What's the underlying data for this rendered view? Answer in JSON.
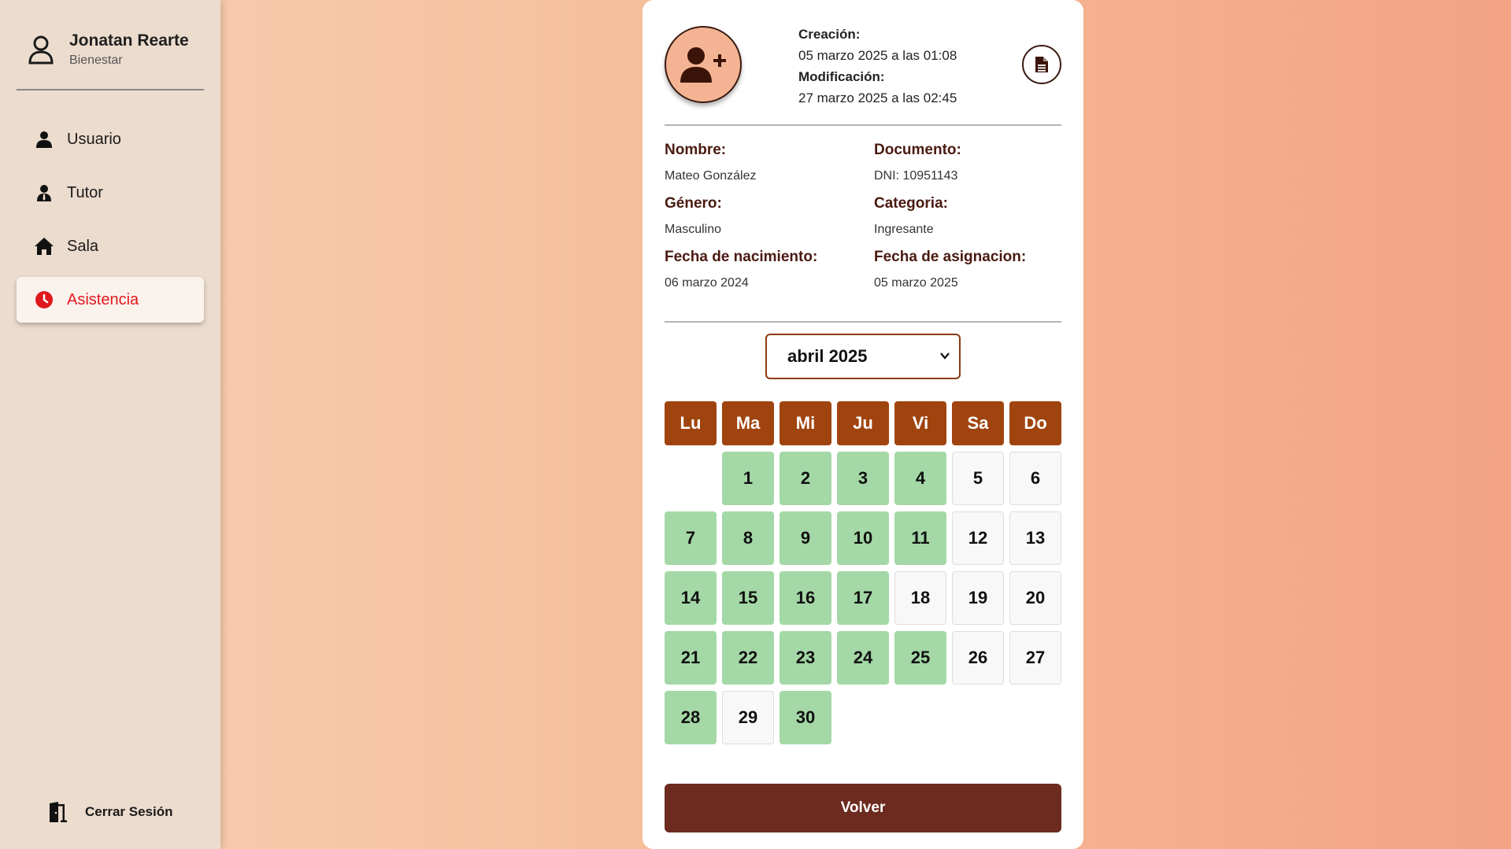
{
  "sidebar": {
    "user_name": "Jonatan Rearte",
    "user_role": "Bienestar",
    "items": [
      {
        "label": "Usuario",
        "icon": "user-icon",
        "active": false
      },
      {
        "label": "Tutor",
        "icon": "tutor-icon",
        "active": false
      },
      {
        "label": "Sala",
        "icon": "home-icon",
        "active": false
      },
      {
        "label": "Asistencia",
        "icon": "clock-icon",
        "active": true
      }
    ],
    "logout_label": "Cerrar Sesión"
  },
  "record": {
    "created_label": "Creación:",
    "created_value": "05 marzo 2025 a las 01:08",
    "modified_label": "Modificación:",
    "modified_value": "27 marzo 2025 a las 02:45"
  },
  "details": {
    "nombre_label": "Nombre:",
    "nombre_value": "Mateo González",
    "documento_label": "Documento:",
    "documento_value": "DNI: 10951143",
    "genero_label": "Género:",
    "genero_value": "Masculino",
    "categoria_label": "Categoria:",
    "categoria_value": "Ingresante",
    "nacimiento_label": "Fecha de nacimiento:",
    "nacimiento_value": "06 marzo 2024",
    "asignacion_label": "Fecha de asignacion:",
    "asignacion_value": "05 marzo 2025"
  },
  "calendar": {
    "selected_month": "abril 2025",
    "weekdays": [
      "Lu",
      "Ma",
      "Mi",
      "Ju",
      "Vi",
      "Sa",
      "Do"
    ],
    "leading_blank_days": 1,
    "days_in_month": 30,
    "present_days": [
      1,
      2,
      3,
      4,
      7,
      8,
      9,
      10,
      11,
      14,
      15,
      16,
      17,
      21,
      22,
      23,
      24,
      25,
      28,
      30
    ],
    "colors": {
      "present": "#a4d8a6",
      "absent": "#f8f8f8",
      "header": "#a0440f"
    }
  },
  "actions": {
    "back_label": "Volver"
  },
  "colors": {
    "active_nav": "#e0191e",
    "primary_button": "#6d2a1f"
  }
}
